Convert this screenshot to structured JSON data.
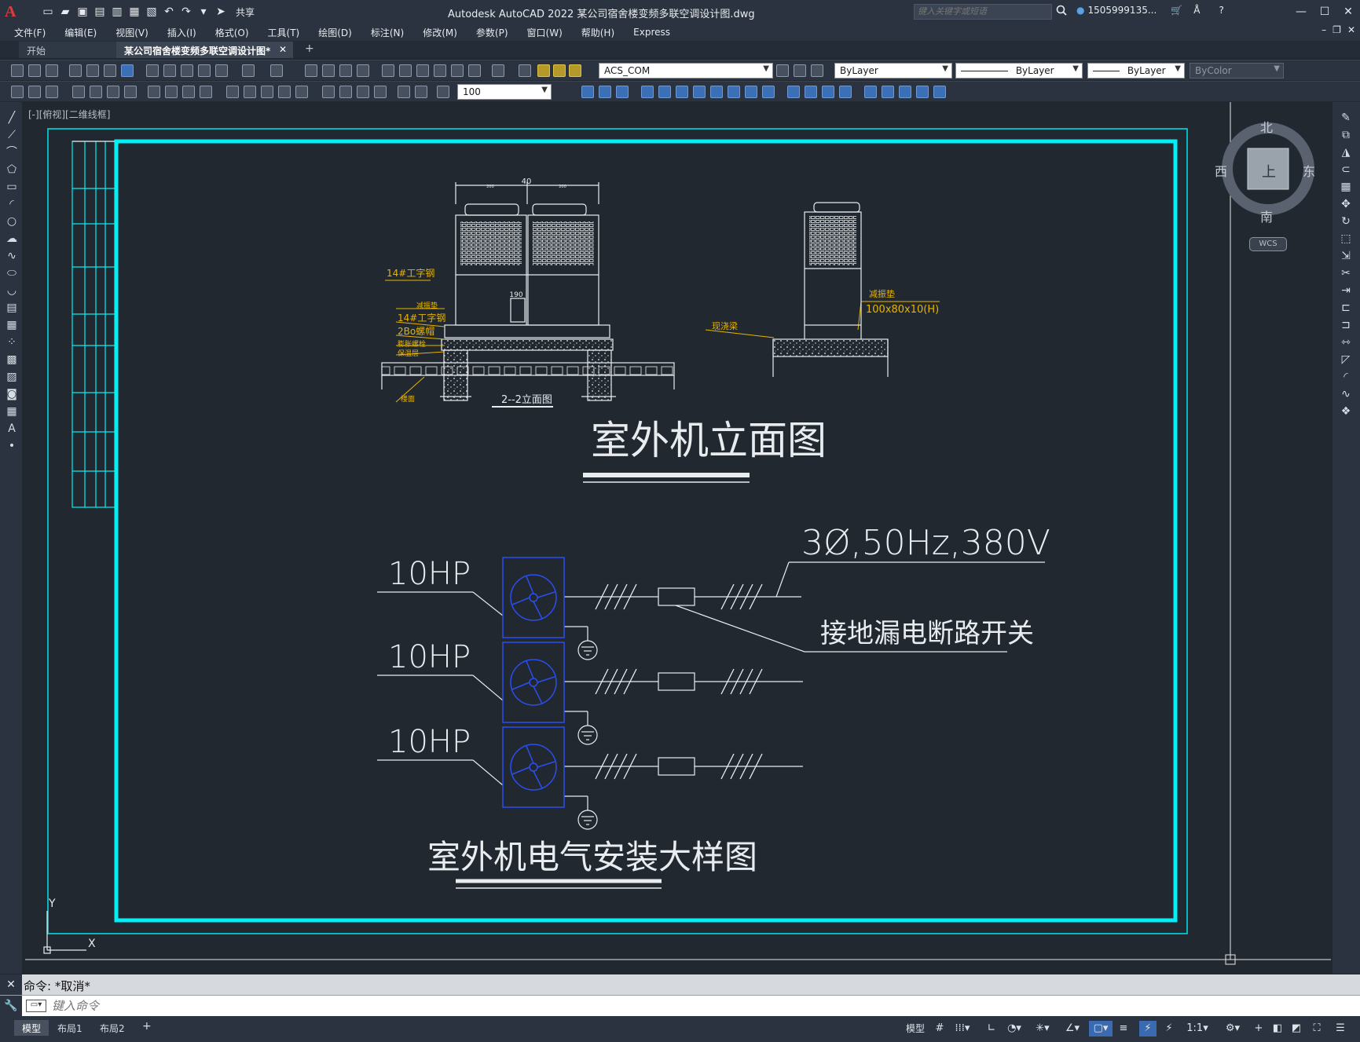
{
  "titlebar": {
    "logo": "A",
    "share_label": "共享",
    "title": "Autodesk AutoCAD 2022    某公司宿舍楼变频多联空调设计图.dwg",
    "search_placeholder": "键入关键字或短语",
    "user": "1505999135...",
    "min": "—",
    "max": "☐",
    "close": "✕"
  },
  "menu": [
    "文件(F)",
    "编辑(E)",
    "视图(V)",
    "插入(I)",
    "格式(O)",
    "工具(T)",
    "绘图(D)",
    "标注(N)",
    "修改(M)",
    "参数(P)",
    "窗口(W)",
    "帮助(H)",
    "Express"
  ],
  "tabs": {
    "start": "开始",
    "doc": "某公司宿舍楼变频多联空调设计图*",
    "close": "✕",
    "add": "+"
  },
  "toolbar": {
    "layer": "ACS_COM",
    "color": "ByLayer",
    "linetype": "ByLayer",
    "lineweight": "ByLayer",
    "plotstyle": "ByColor",
    "scale": "100"
  },
  "viewport": {
    "label": "[-][俯视][二维线框]"
  },
  "viewcube": {
    "north": "北",
    "south": "南",
    "east": "东",
    "west": "西",
    "top": "上",
    "wcs": "WCS"
  },
  "drawing": {
    "elevation": {
      "dim_top": "40",
      "dim_left": "200",
      "dim_right": "200",
      "dim_mid": "190",
      "label_steel_top": "14#工字钢",
      "label_damper": "减振垫",
      "label_steel": "14#工字钢",
      "label_bolt": "2Bo螺帽",
      "label_foundation_bolt": "膨胀螺栓",
      "label_insulation": "保温层",
      "label_slab": "楼面",
      "section_label": "2--2立面图",
      "right_damper": "减振垫",
      "right_damper_size": "100x80x10(H)",
      "right_beam": "现浇梁",
      "title": "室外机立面图"
    },
    "electrical": {
      "hp": [
        "10HP",
        "10HP",
        "10HP"
      ],
      "power": "3Ø,50Hz,380V",
      "breaker": "接地漏电断路开关",
      "title": "室外机电气安装大样图"
    },
    "axes": {
      "x": "X",
      "y": "Y"
    }
  },
  "command": {
    "history": "命令: *取消*",
    "placeholder": "键入命令"
  },
  "status": {
    "tabs": [
      "模型",
      "布局1",
      "布局2"
    ],
    "add": "+",
    "model": "模型",
    "scale": "1:1"
  },
  "colors": {
    "cyan_frame": "#00f0f5",
    "drawing_white": "#e8ecef",
    "annotation_yellow": "#e8b400",
    "fan_blue": "#2a4ef0",
    "canvas_bg": "#212830"
  }
}
